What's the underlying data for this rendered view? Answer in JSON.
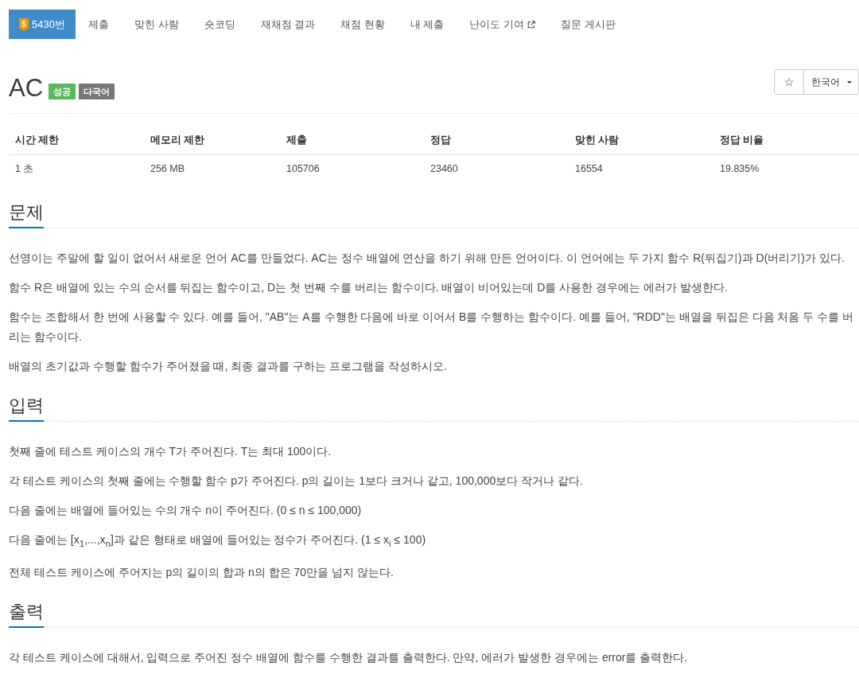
{
  "nav": {
    "tabs": [
      {
        "kind": "problem",
        "badge": "5",
        "label": "5430번",
        "selected": true
      },
      {
        "kind": "link",
        "label": "제출",
        "selected": false
      },
      {
        "kind": "link",
        "label": "맞힌 사람",
        "selected": false
      },
      {
        "kind": "link",
        "label": "숏코딩",
        "selected": false
      },
      {
        "kind": "link",
        "label": "재채점 결과",
        "selected": false
      },
      {
        "kind": "link",
        "label": "채점 현황",
        "selected": false
      },
      {
        "kind": "link",
        "label": "내 제출",
        "selected": false
      },
      {
        "kind": "external",
        "label": "난이도 기여",
        "selected": false
      },
      {
        "kind": "link",
        "label": "질문 게시판",
        "selected": false
      }
    ]
  },
  "header": {
    "title": "AC",
    "labels": [
      {
        "text": "성공",
        "color": "#5cb85c"
      },
      {
        "text": "다국어",
        "color": "#777777"
      }
    ],
    "favorite": "☆",
    "language": "한국어"
  },
  "stats": {
    "columns": [
      "시간 제한",
      "메모리 제한",
      "제출",
      "정답",
      "맞힌 사람",
      "정답 비율"
    ],
    "rows": [
      [
        "1 초",
        "256 MB",
        "105706",
        "23460",
        "16554",
        "19.835%"
      ]
    ]
  },
  "sections": [
    {
      "title": "문제",
      "paragraphs": [
        "선영이는 주말에 할 일이 없어서 새로운 언어 AC를 만들었다. AC는 정수 배열에 연산을 하기 위해 만든 언어이다. 이 언어에는 두 가지 함수 R(뒤집기)과 D(버리기)가 있다.",
        "함수 R은 배열에 있는 수의 순서를 뒤집는 함수이고, D는 첫 번째 수를 버리는 함수이다. 배열이 비어있는데 D를 사용한 경우에는 에러가 발생한다.",
        "함수는 조합해서 한 번에 사용할 수 있다. 예를 들어, \"AB\"는 A를 수행한 다음에 바로 이어서 B를 수행하는 함수이다. 예를 들어, \"RDD\"는 배열을 뒤집은 다음 처음 두 수를 버리는 함수이다.",
        "배열의 초기값과 수행할 함수가 주어졌을 때, 최종 결과를 구하는 프로그램을 작성하시오."
      ]
    },
    {
      "title": "입력",
      "paragraphs": [
        "첫째 줄에 테스트 케이스의 개수 T가 주어진다. T는 최대 100이다.",
        "각 테스트 케이스의 첫째 줄에는 수행할 함수 p가 주어진다. p의 길이는 1보다 크거나 같고, 100,000보다 작거나 같다.",
        "다음 줄에는 배열에 들어있는 수의 개수 n이 주어진다. (0 ≤ n ≤ 100,000)",
        "다음 줄에는 [x$_{1}$,...,x$_{n}$]과 같은 형태로 배열에 들어있는 정수가 주어진다. (1 ≤ x$_{i}$ ≤ 100)",
        "전체 테스트 케이스에 주어지는 p의 길이의 합과 n의 합은 70만을 넘지 않는다."
      ]
    },
    {
      "title": "출력",
      "paragraphs": [
        "각 테스트 케이스에 대해서, 입력으로 주어진 정수 배열에 함수를 수행한 결과를 출력한다. 만약, 에러가 발생한 경우에는 error를 출력한다."
      ]
    }
  ]
}
